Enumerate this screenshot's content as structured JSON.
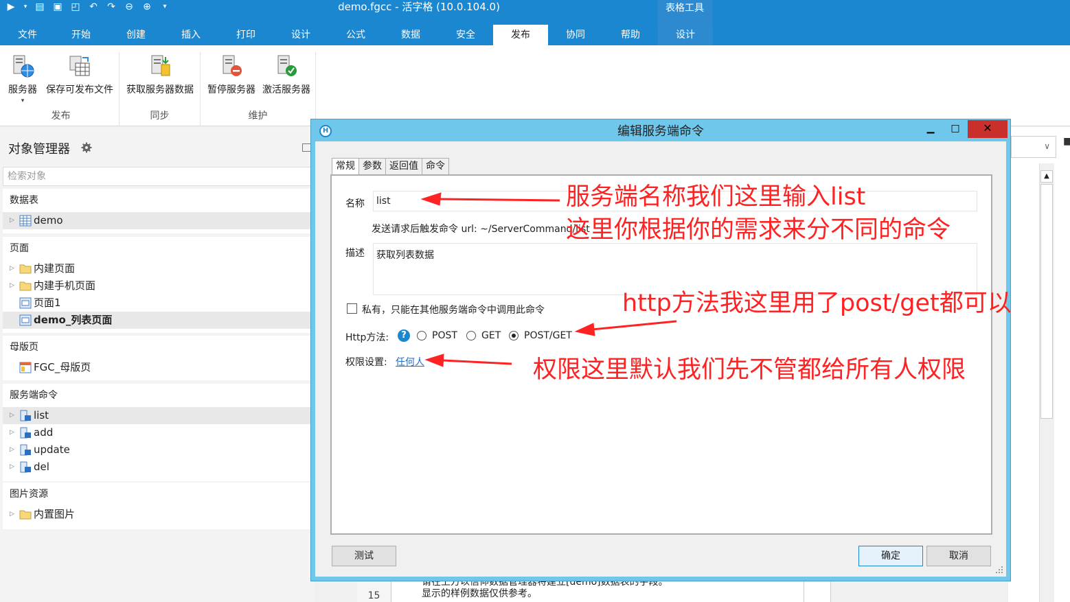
{
  "window": {
    "title": "demo.fgcc - 活字格 (10.0.104.0)",
    "context_tab_group": "表格工具"
  },
  "ribbon_tabs": [
    "文件",
    "开始",
    "创建",
    "插入",
    "打印",
    "设计",
    "公式",
    "数据",
    "安全",
    "发布",
    "协同",
    "帮助",
    "设计"
  ],
  "ribbon_active_tab": "发布",
  "ribbon": {
    "groups": [
      {
        "label": "发布",
        "buttons": [
          "服务器",
          "保存可发布文件"
        ]
      },
      {
        "label": "同步",
        "buttons": [
          "获取服务器数据"
        ]
      },
      {
        "label": "维护",
        "buttons": [
          "暂停服务器",
          "激活服务器"
        ]
      }
    ]
  },
  "object_manager": {
    "title": "对象管理器",
    "search_placeholder": "检索对象",
    "sections": [
      {
        "title": "数据表",
        "items": [
          "demo"
        ]
      },
      {
        "title": "页面",
        "items": [
          "内建页面",
          "内建手机页面",
          "页面1",
          "demo_列表页面"
        ]
      },
      {
        "title": "母版页",
        "items": [
          "FGC_母版页"
        ]
      },
      {
        "title": "服务端命令",
        "items": [
          "list",
          "add",
          "update",
          "del"
        ]
      },
      {
        "title": "图片资源",
        "items": [
          "内置图片"
        ]
      }
    ]
  },
  "background_grid": {
    "row_number": "15",
    "text_line1": "请在上方以信仰数据管理器将建立[demo]数据表的字段。",
    "text_line2": "显示的样例数据仅供参考。"
  },
  "dialog": {
    "title": "编辑服务端命令",
    "tabs": [
      "常规",
      "参数",
      "返回值",
      "命令"
    ],
    "active_tab": "常规",
    "name_label": "名称",
    "name_value": "list",
    "url_hint": "发送请求后触发命令 url: ~/ServerCommand/list",
    "desc_label": "描述",
    "desc_value": "获取列表数据",
    "private_label": "私有，只能在其他服务端命令中调用此命令",
    "private_checked": false,
    "http_label": "Http方法:",
    "http_options": [
      "POST",
      "GET",
      "POST/GET"
    ],
    "http_selected": "POST/GET",
    "permission_label": "权限设置:",
    "permission_value": "任何人",
    "test_button": "测试",
    "ok_button": "确定",
    "cancel_button": "取消"
  },
  "annotations": {
    "name_note": "服务端名称我们这里输入list",
    "command_note": "这里你根据你的需求来分不同的命令",
    "http_note": "http方法我这里用了post/get都可以",
    "permission_note": "权限这里默认我们先不管都给所有人权限",
    "color": "#ff2222"
  },
  "colors": {
    "title_bar": "#1b87d1",
    "dialog_frame": "#6fc8ec",
    "close_button": "#c9302c"
  }
}
